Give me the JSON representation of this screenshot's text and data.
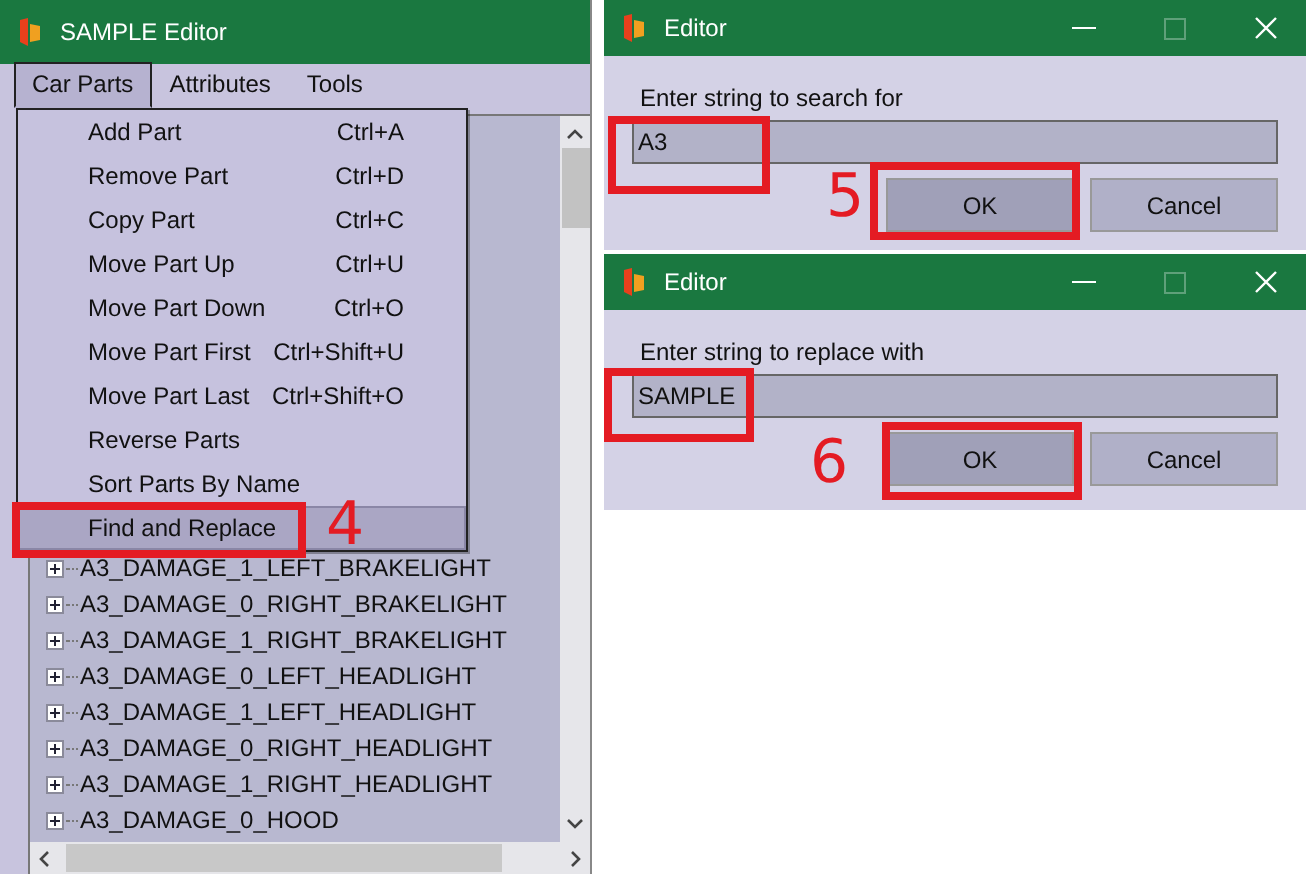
{
  "main_window": {
    "title": "SAMPLE Editor",
    "menu_bar": [
      {
        "label": "Car Parts",
        "selected": true
      },
      {
        "label": "Attributes",
        "selected": false
      },
      {
        "label": "Tools",
        "selected": false
      }
    ],
    "menu": {
      "items": [
        {
          "label": "Add Part",
          "shortcut": "Ctrl+A",
          "selected": false
        },
        {
          "label": "Remove Part",
          "shortcut": "Ctrl+D",
          "selected": false
        },
        {
          "label": "Copy Part",
          "shortcut": "Ctrl+C",
          "selected": false
        },
        {
          "label": "Move Part Up",
          "shortcut": "Ctrl+U",
          "selected": false
        },
        {
          "label": "Move Part Down",
          "shortcut": "Ctrl+O",
          "selected": false
        },
        {
          "label": "Move Part First",
          "shortcut": "Ctrl+Shift+U",
          "selected": false
        },
        {
          "label": "Move Part Last",
          "shortcut": "Ctrl+Shift+O",
          "selected": false
        },
        {
          "label": "Reverse Parts",
          "selected": false
        },
        {
          "label": "Sort Parts By Name",
          "selected": false
        },
        {
          "label": "Find and Replace",
          "selected": true,
          "annotation": "4"
        }
      ]
    },
    "tree": [
      {
        "label": "A3_DAMAGE_1_LEFT_BRAKELIGHT",
        "expanded": false
      },
      {
        "label": "A3_DAMAGE_0_RIGHT_BRAKELIGHT",
        "expanded": false
      },
      {
        "label": "A3_DAMAGE_1_RIGHT_BRAKELIGHT",
        "expanded": false
      },
      {
        "label": "A3_DAMAGE_0_LEFT_HEADLIGHT",
        "expanded": false
      },
      {
        "label": "A3_DAMAGE_1_LEFT_HEADLIGHT",
        "expanded": false
      },
      {
        "label": "A3_DAMAGE_0_RIGHT_HEADLIGHT",
        "expanded": false
      },
      {
        "label": "A3_DAMAGE_1_RIGHT_HEADLIGHT",
        "expanded": false
      },
      {
        "label": "A3_DAMAGE_0_HOOD",
        "expanded": false
      }
    ]
  },
  "dialogs": [
    {
      "title": "Editor",
      "prompt": "Enter string to search for",
      "value": "A3",
      "buttons": [
        "OK",
        "Cancel"
      ],
      "annotation": "5"
    },
    {
      "title": "Editor",
      "prompt": "Enter string to replace with",
      "value": "SAMPLE",
      "buttons": [
        "OK",
        "Cancel"
      ],
      "annotation": "6"
    }
  ]
}
